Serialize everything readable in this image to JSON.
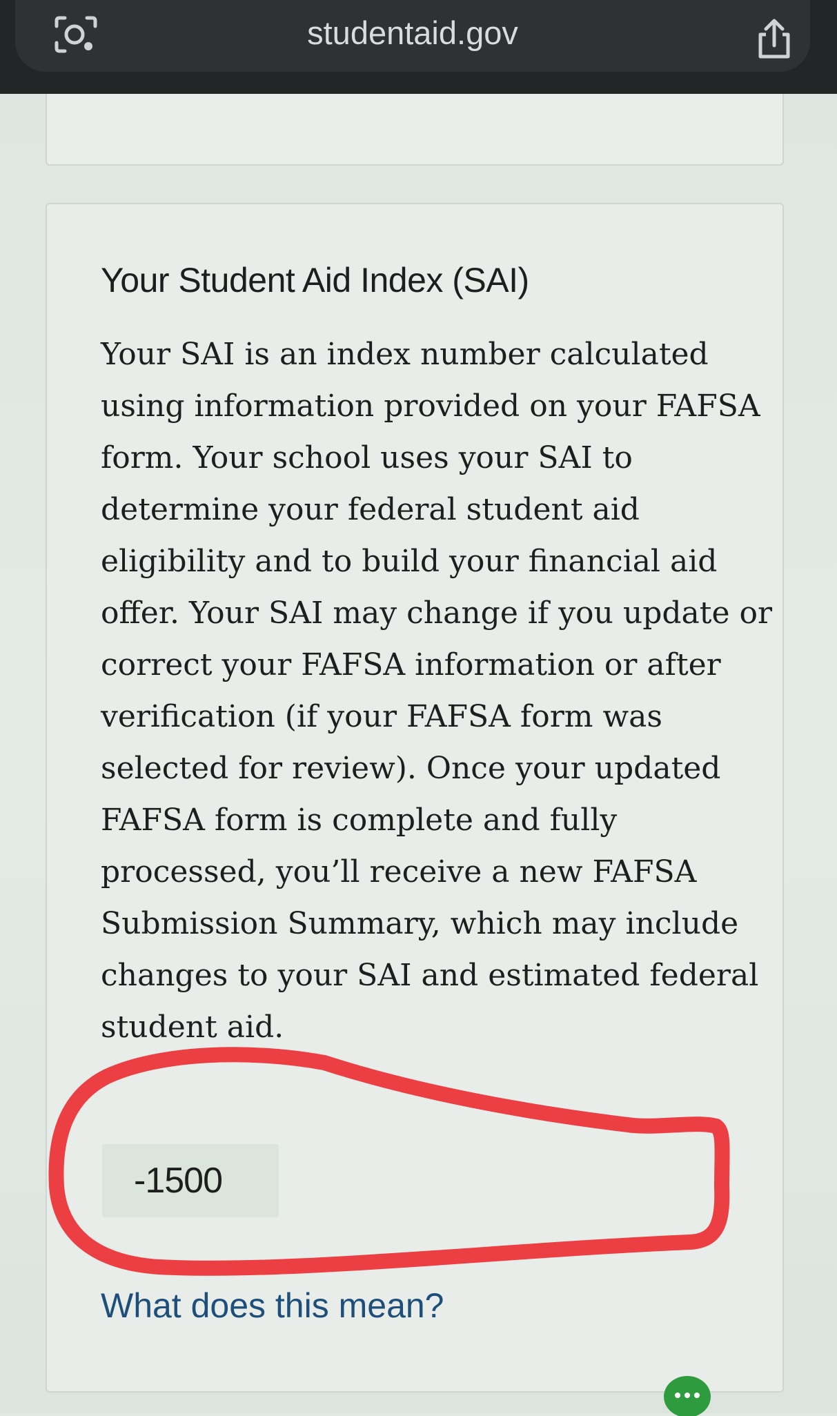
{
  "browser": {
    "url": "studentaid.gov",
    "lens_icon": "camera-lens-icon",
    "share_icon": "share-icon"
  },
  "card": {
    "title": "Your Student Aid Index (SAI)",
    "body": "Your SAI is an index number calculated using information provided on your FAFSA form. Your school uses your SAI to determine your federal student aid eligibility and to build your financial aid offer. Your SAI may change if you update or correct your FAFSA information or after verification (if your FAFSA form was selected for review). Once your updated FAFSA form is complete and fully processed, you’ll receive a new FAFSA Submission Summary, which may include changes to your SAI and estimated federal student aid.",
    "sai_value": "-1500",
    "link": "What does this mean?"
  },
  "annotation": {
    "shape": "hand-drawn-loop",
    "color": "#ec3f44"
  },
  "chat": {
    "icon": "chat-bubble-icon",
    "color": "#2e9b3e"
  }
}
